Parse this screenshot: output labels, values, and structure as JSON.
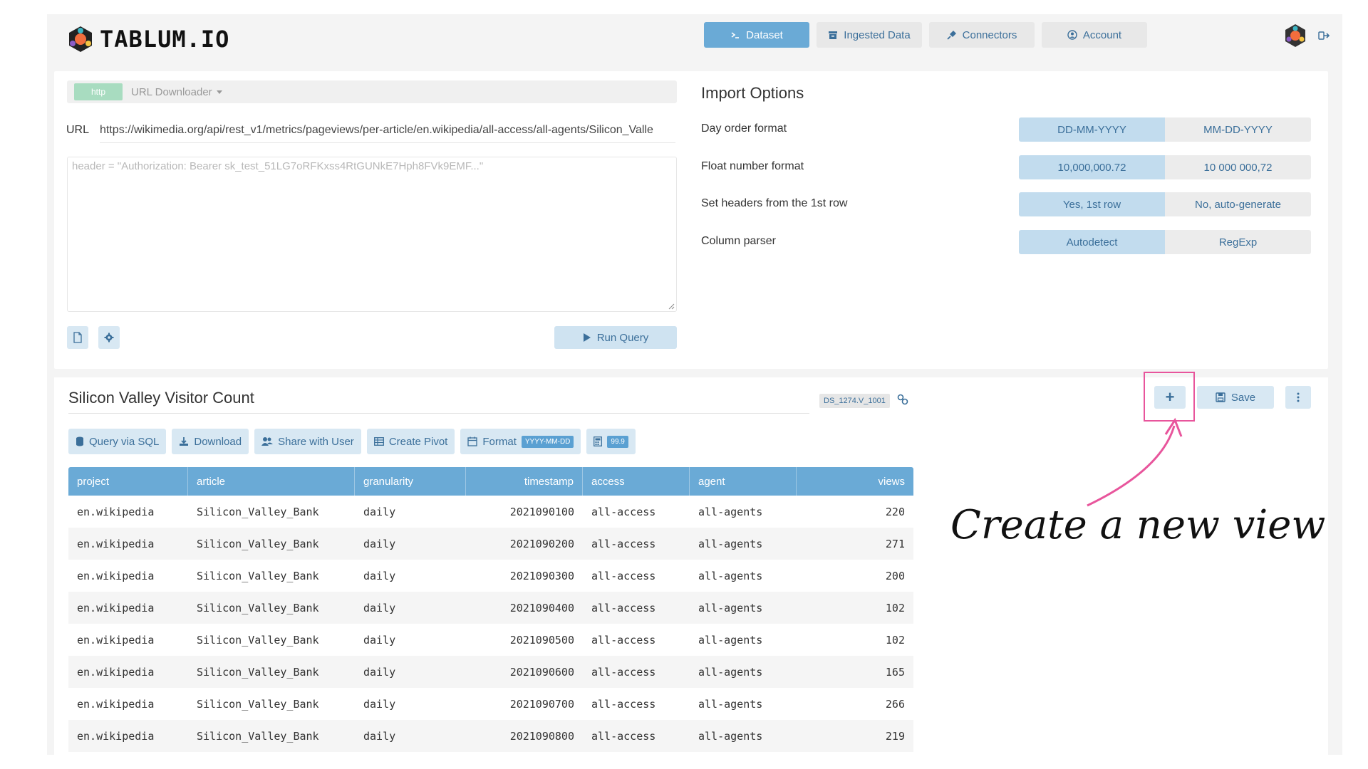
{
  "header": {
    "logo_text": "TABLUM.IO",
    "nav": [
      {
        "label": "Dataset",
        "active": true,
        "icon": "terminal-icon"
      },
      {
        "label": "Ingested Data",
        "active": false,
        "icon": "archive-icon"
      },
      {
        "label": "Connectors",
        "active": false,
        "icon": "plug-icon"
      },
      {
        "label": "Account",
        "active": false,
        "icon": "user-circle-icon"
      }
    ]
  },
  "query": {
    "source_badge": "http",
    "source_label": "URL Downloader",
    "url_label": "URL",
    "url_value": "https://wikimedia.org/api/rest_v1/metrics/pageviews/per-article/en.wikipedia/all-access/all-agents/Silicon_Valle",
    "headers_placeholder": "header = \"Authorization: Bearer sk_test_51LG7oRFKxss4RtGUNkE7Hph8FVk9EMF...\"",
    "run_label": "Run Query"
  },
  "import_options": {
    "title": "Import Options",
    "options": [
      {
        "label": "Day order format",
        "choices": [
          "DD-MM-YYYY",
          "MM-DD-YYYY"
        ],
        "selected": 0
      },
      {
        "label": "Float number format",
        "choices": [
          "10,000,000.72",
          "10 000 000,72"
        ],
        "selected": 0
      },
      {
        "label": "Set headers from the 1st row",
        "choices": [
          "Yes, 1st row",
          "No, auto-generate"
        ],
        "selected": 0
      },
      {
        "label": "Column parser",
        "choices": [
          "Autodetect",
          "RegExp"
        ],
        "selected": 0
      }
    ]
  },
  "dataset": {
    "title": "Silicon Valley Visitor Count",
    "id": "DS_1274.V_1001",
    "save_label": "Save",
    "plus_label": "+",
    "toolbar": {
      "query_sql": "Query via SQL",
      "download": "Download",
      "share": "Share with User",
      "pivot": "Create Pivot",
      "format": "Format",
      "format_badge": "YYYY-MM-DD",
      "number_badge": "99.9"
    },
    "columns": [
      "project",
      "article",
      "granularity",
      "timestamp",
      "access",
      "agent",
      "views"
    ],
    "rows": [
      [
        "en.wikipedia",
        "Silicon_Valley_Bank",
        "daily",
        "2021090100",
        "all-access",
        "all-agents",
        "220"
      ],
      [
        "en.wikipedia",
        "Silicon_Valley_Bank",
        "daily",
        "2021090200",
        "all-access",
        "all-agents",
        "271"
      ],
      [
        "en.wikipedia",
        "Silicon_Valley_Bank",
        "daily",
        "2021090300",
        "all-access",
        "all-agents",
        "200"
      ],
      [
        "en.wikipedia",
        "Silicon_Valley_Bank",
        "daily",
        "2021090400",
        "all-access",
        "all-agents",
        "102"
      ],
      [
        "en.wikipedia",
        "Silicon_Valley_Bank",
        "daily",
        "2021090500",
        "all-access",
        "all-agents",
        "102"
      ],
      [
        "en.wikipedia",
        "Silicon_Valley_Bank",
        "daily",
        "2021090600",
        "all-access",
        "all-agents",
        "165"
      ],
      [
        "en.wikipedia",
        "Silicon_Valley_Bank",
        "daily",
        "2021090700",
        "all-access",
        "all-agents",
        "266"
      ],
      [
        "en.wikipedia",
        "Silicon_Valley_Bank",
        "daily",
        "2021090800",
        "all-access",
        "all-agents",
        "219"
      ]
    ]
  },
  "annotation": {
    "text": "Create a new view",
    "color": "#e8559c"
  },
  "colors": {
    "accent": "#6aaad6",
    "button_bg": "#d8e8f3",
    "highlight": "#e8559c"
  }
}
